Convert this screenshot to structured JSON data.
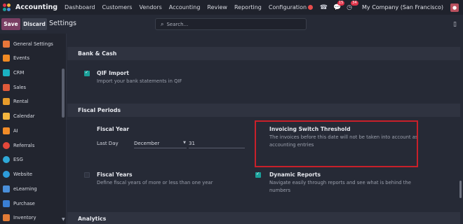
{
  "navbar": {
    "app_name": "Accounting",
    "menu": [
      "Dashboard",
      "Customers",
      "Vendors",
      "Accounting",
      "Review",
      "Reporting",
      "Configuration"
    ],
    "messages_badge": "15",
    "activity_badge": "34",
    "company": "My Company (San Francisco)"
  },
  "control_panel": {
    "save_label": "Save",
    "discard_label": "Discard",
    "title": "Settings",
    "search_placeholder": "Search..."
  },
  "sidebar": {
    "items": [
      {
        "label": "General Settings",
        "icon": "gear-icon",
        "color": "#e8763a"
      },
      {
        "label": "Events",
        "icon": "events-icon",
        "color": "#f08a24"
      },
      {
        "label": "CRM",
        "icon": "crm-icon",
        "color": "#1ab1c2"
      },
      {
        "label": "Sales",
        "icon": "sales-icon",
        "color": "#e05a3a"
      },
      {
        "label": "Rental",
        "icon": "rental-icon",
        "color": "#e79c2b"
      },
      {
        "label": "Calendar",
        "icon": "calendar-icon",
        "color": "#f3b63f"
      },
      {
        "label": "AI",
        "icon": "ai-icon",
        "color": "#f28c28"
      },
      {
        "label": "Referrals",
        "icon": "referrals-icon",
        "color": "#e4473a"
      },
      {
        "label": "ESG",
        "icon": "esg-icon",
        "color": "#2fa9d8"
      },
      {
        "label": "Website",
        "icon": "website-icon",
        "color": "#2d9cdb"
      },
      {
        "label": "eLearning",
        "icon": "elearning-icon",
        "color": "#4a8fd9"
      },
      {
        "label": "Purchase",
        "icon": "purchase-icon",
        "color": "#3a7fd4"
      },
      {
        "label": "Inventory",
        "icon": "inventory-icon",
        "color": "#e27b36"
      }
    ]
  },
  "sections": {
    "bank_cash": "Bank & Cash",
    "fiscal_periods": "Fiscal Periods",
    "analytics": "Analytics"
  },
  "settings": {
    "qif_title": "QIF Import",
    "qif_desc": "Import your bank statements in QIF",
    "qif_checked": true,
    "fiscal_year_title": "Fiscal Year",
    "last_day_label": "Last Day",
    "last_day_month": "December",
    "last_day_day": "31",
    "invoicing_title": "Invoicing Switch Threshold",
    "invoicing_desc": "The invoices before this date will not be taken into account as accounting entries",
    "fiscal_years_title": "Fiscal Years",
    "fiscal_years_desc": "Define fiscal years of more or less than one year",
    "fiscal_years_checked": false,
    "dynamic_title": "Dynamic Reports",
    "dynamic_desc": "Navigate easily through reports and see what is behind the numbers",
    "dynamic_checked": true
  },
  "colors": {
    "primary": "#7a3e63",
    "checkbox_on": "#1aa09a",
    "highlight": "#c8202a"
  }
}
